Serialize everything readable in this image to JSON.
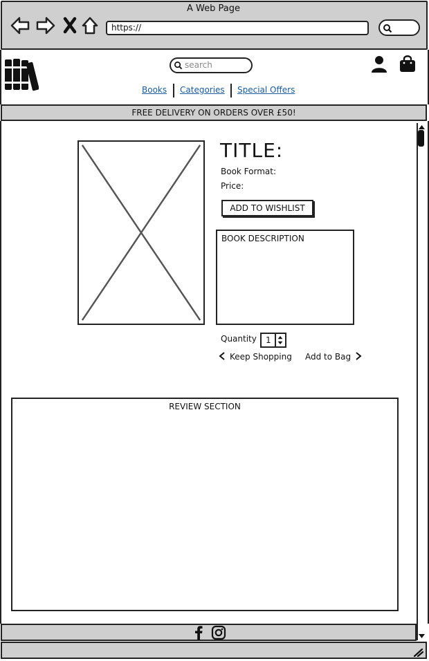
{
  "browser": {
    "title": "A Web Page",
    "url": "https://"
  },
  "header": {
    "search_placeholder": "search",
    "nav": [
      "Books",
      "Categories",
      "Special Offers"
    ]
  },
  "banner": "FREE DELIVERY ON ORDERS OVER £50!",
  "product": {
    "title": "TITLE:",
    "format_label": "Book Format:",
    "price_label": "Price:",
    "wishlist_label": "ADD TO WISHLIST",
    "description_label": "BOOK DESCRIPTION",
    "quantity_label": "Quantity",
    "quantity_value": "1",
    "keep_shopping_label": "Keep Shopping",
    "add_to_bag_label": "Add to Bag"
  },
  "reviews": {
    "label": "REVIEW SECTION"
  },
  "icons": {
    "back": "back-arrow-icon",
    "forward": "forward-arrow-icon",
    "close": "close-icon",
    "home": "home-icon",
    "search": "search-icon",
    "logo": "books-logo-icon",
    "user": "user-icon",
    "bag": "shopping-bag-icon",
    "facebook": "facebook-icon",
    "instagram": "instagram-icon",
    "resize": "resize-grip-icon"
  }
}
